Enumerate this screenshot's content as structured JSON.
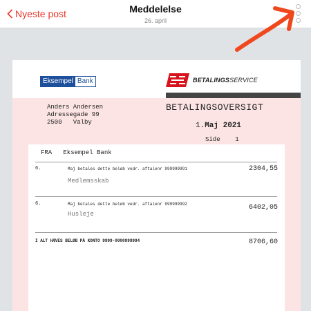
{
  "nav": {
    "back_label": "Nyeste post",
    "title": "Meddelelse",
    "date": "26. april"
  },
  "colors": {
    "accent": "#e8352b",
    "arrow": "#f0481e",
    "brand_blue": "#1d4f9c",
    "brand_red": "#d7141b",
    "pink_bg": "#fde4e4"
  },
  "icons": {
    "back": "chevron-left-icon",
    "more": "more-dots-icon",
    "annotation": "arrow-icon"
  },
  "letter": {
    "bank_logo": {
      "part1": "Eksempel",
      "part2": "Bank"
    },
    "betalingsservice_logo": {
      "bold": "BETALINGS",
      "light": "SERVICE"
    },
    "recipient": {
      "name": "Anders Andersen",
      "street": "Adressegade 99",
      "city": "2500   Valby"
    },
    "heading": "BETALINGSOVERSIGT",
    "date_prefix": "1.",
    "date_main": "Maj 2021",
    "page_label": "Side",
    "page_number": "1",
    "from_line": "FRA   Eksempel Bank",
    "rows": [
      {
        "num": "6.",
        "text": "Maj betales dette beløb vedr. aftalenr 999999991",
        "amount": "2304,55",
        "sub": "Medlemsskab"
      },
      {
        "num": "6.",
        "text": "Maj betales dette beløb vedr. aftalenr 999999992",
        "amount": "6402,05",
        "sub": "Husleje"
      }
    ],
    "total_label": "I ALT HÆVES BELØB PÅ KONTO 9999-0000999994",
    "total_amount": "8706,60"
  }
}
